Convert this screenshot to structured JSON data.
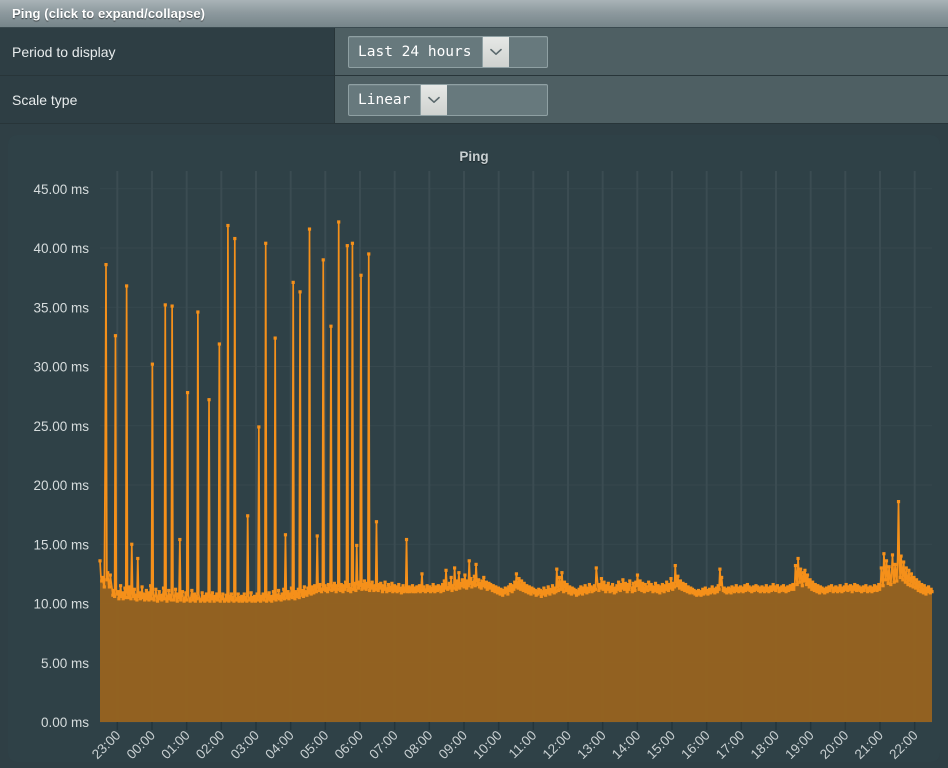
{
  "panel": {
    "header_title": "Ping (click to expand/collapse)"
  },
  "form": {
    "rows": [
      {
        "label": "Period to display",
        "control_name": "period-select",
        "value": "Last 24 hours",
        "arrow_icon": "chevron-down-icon"
      },
      {
        "label": "Scale type",
        "control_name": "scale-select",
        "value": "Linear",
        "arrow_icon": "chevron-down-icon"
      }
    ]
  },
  "colors": {
    "header_light": "#a9b3b7",
    "header_dark": "#76858a",
    "label_bg": "#2e3e44",
    "control_bg": "#4e5f63",
    "chart_bg": "#2f4147",
    "grid_line": "#3b4c52",
    "series_line": "#f5901a",
    "series_fill": "#96631f",
    "tick_text": "#d6dcdd"
  },
  "chart_data": {
    "type": "area",
    "title": "Ping",
    "xlabel": "",
    "ylabel": "",
    "unit": "ms",
    "grid": true,
    "legend": "none",
    "ylim": [
      0,
      46.5
    ],
    "ytick_values": [
      0,
      5,
      10,
      15,
      20,
      25,
      30,
      35,
      40,
      45
    ],
    "ytick_labels": [
      "0.00 ms",
      "5.00 ms",
      "10.00 ms",
      "15.00 ms",
      "20.00 ms",
      "25.00 ms",
      "30.00 ms",
      "35.00 ms",
      "40.00 ms",
      "45.00 ms"
    ],
    "xtick_labels": [
      "23:00",
      "00:00",
      "01:00",
      "02:00",
      "03:00",
      "04:00",
      "05:00",
      "06:00",
      "07:00",
      "08:00",
      "09:00",
      "10:00",
      "11:00",
      "12:00",
      "13:00",
      "14:00",
      "15:00",
      "16:00",
      "17:00",
      "18:00",
      "19:00",
      "20:00",
      "21:00",
      "22:00"
    ],
    "series": [
      {
        "name": "Ping",
        "line_color": "#f5901a",
        "fill_color": "#96631f",
        "values": [
          13.6,
          12.3,
          11.9,
          12.2,
          11.7,
          11.4,
          22.0,
          38.6,
          12.0,
          12.6,
          11.6,
          11.4,
          12.4,
          11.8,
          11.3,
          10.7,
          11.1,
          10.6,
          32.6,
          11.2,
          10.8,
          11.0,
          10.4,
          10.7,
          11.5,
          10.6,
          10.9,
          10.4,
          10.7,
          11.3,
          10.5,
          36.8,
          10.9,
          10.5,
          11.4,
          10.7,
          10.4,
          15.0,
          10.8,
          10.6,
          11.2,
          10.4,
          10.7,
          10.3,
          13.8,
          10.6,
          10.9,
          10.4,
          10.7,
          11.4,
          10.5,
          10.8,
          10.3,
          10.6,
          11.1,
          10.4,
          10.9,
          10.3,
          10.6,
          11.5,
          10.4,
          30.2,
          10.8,
          10.3,
          10.6,
          11.2,
          10.5,
          10.2,
          10.8,
          11.0,
          10.4,
          10.7,
          10.3,
          10.6,
          11.3,
          10.4,
          35.2,
          10.8,
          10.2,
          10.6,
          11.1,
          10.4,
          10.7,
          10.3,
          35.1,
          10.8,
          10.3,
          10.6,
          11.2,
          10.4,
          10.2,
          10.8,
          10.5,
          15.4,
          10.3,
          10.7,
          11.0,
          10.4,
          10.2,
          10.6,
          10.9,
          10.3,
          27.8,
          10.7,
          10.4,
          10.2,
          10.6,
          11.1,
          10.3,
          10.5,
          10.8,
          10.2,
          10.6,
          10.4,
          34.6,
          10.8,
          10.3,
          10.2,
          10.5,
          10.9,
          10.3,
          10.6,
          10.2,
          10.4,
          10.8,
          10.3,
          10.5,
          27.2,
          10.2,
          10.7,
          10.4,
          10.9,
          10.3,
          10.2,
          10.6,
          10.4,
          10.8,
          10.3,
          10.5,
          31.9,
          10.2,
          10.6,
          10.4,
          10.8,
          10.3,
          10.2,
          10.5,
          10.7,
          10.3,
          41.9,
          10.2,
          10.6,
          10.4,
          10.8,
          10.3,
          10.5,
          10.2,
          40.8,
          10.6,
          10.3,
          10.4,
          10.8,
          10.2,
          10.5,
          10.3,
          10.6,
          10.2,
          10.4,
          10.8,
          10.3,
          10.5,
          10.2,
          17.4,
          10.6,
          10.3,
          10.4,
          10.9,
          10.2,
          10.5,
          10.3,
          10.6,
          10.2,
          10.4,
          10.8,
          10.3,
          24.9,
          10.5,
          10.2,
          10.6,
          10.4,
          10.8,
          10.3,
          10.5,
          40.4,
          10.2,
          10.7,
          10.4,
          10.9,
          10.3,
          10.6,
          10.2,
          10.5,
          11.0,
          10.4,
          32.4,
          10.3,
          10.7,
          10.5,
          11.1,
          10.4,
          10.6,
          10.3,
          10.8,
          10.5,
          11.2,
          10.4,
          15.8,
          10.7,
          10.5,
          11.0,
          10.4,
          10.8,
          10.6,
          11.3,
          10.5,
          37.1,
          10.7,
          10.4,
          11.0,
          10.8,
          10.6,
          11.2,
          10.5,
          36.3,
          10.9,
          10.7,
          11.1,
          10.6,
          11.4,
          10.8,
          11.0,
          10.7,
          11.3,
          10.9,
          41.6,
          11.0,
          10.8,
          11.4,
          11.1,
          10.9,
          11.5,
          11.2,
          11.0,
          15.7,
          11.3,
          11.1,
          11.6,
          11.2,
          11.0,
          11.4,
          39.0,
          11.2,
          11.5,
          11.1,
          11.3,
          11.0,
          11.6,
          11.2,
          11.4,
          33.4,
          11.1,
          11.5,
          11.2,
          11.7,
          11.3,
          11.0,
          11.5,
          11.2,
          42.2,
          11.4,
          11.1,
          11.6,
          11.3,
          11.0,
          11.5,
          11.2,
          11.8,
          11.4,
          40.2,
          11.1,
          11.6,
          11.3,
          11.0,
          11.5,
          40.4,
          11.2,
          11.7,
          11.4,
          11.1,
          14.9,
          11.6,
          11.3,
          11.8,
          11.5,
          37.7,
          11.2,
          11.6,
          11.3,
          11.9,
          11.5,
          11.2,
          11.7,
          11.4,
          39.5,
          11.1,
          11.6,
          11.3,
          11.8,
          11.4,
          11.1,
          11.5,
          11.2,
          16.9,
          11.4,
          11.1,
          11.6,
          11.3,
          11.7,
          11.2,
          11.0,
          11.5,
          11.2,
          11.8,
          11.4,
          11.0,
          11.3,
          11.6,
          11.1,
          11.4,
          11.2,
          11.7,
          11.0,
          11.3,
          11.5,
          11.1,
          11.4,
          11.0,
          11.2,
          11.6,
          11.1,
          11.3,
          10.9,
          11.2,
          11.5,
          11.0,
          11.3,
          11.1,
          15.4,
          11.0,
          11.2,
          11.4,
          11.0,
          11.3,
          11.1,
          11.5,
          11.0,
          11.2,
          11.3,
          11.0,
          11.4,
          11.1,
          11.2,
          11.5,
          11.0,
          11.3,
          12.5,
          11.1,
          11.4,
          11.2,
          11.0,
          11.3,
          11.5,
          11.1,
          11.2,
          11.4,
          11.0,
          11.3,
          11.1,
          11.6,
          11.2,
          11.0,
          11.4,
          11.3,
          11.1,
          11.5,
          11.2,
          11.4,
          11.0,
          11.3,
          11.6,
          11.1,
          11.9,
          11.3,
          12.8,
          11.5,
          11.2,
          11.4,
          11.7,
          11.3,
          12.2,
          11.1,
          11.5,
          11.3,
          13.0,
          11.6,
          11.2,
          11.9,
          11.4,
          12.6,
          11.3,
          11.7,
          11.5,
          12.0,
          11.8,
          11.4,
          12.4,
          11.6,
          11.3,
          11.9,
          11.5,
          13.6,
          11.7,
          12.1,
          11.4,
          11.8,
          11.6,
          12.3,
          11.5,
          13.3,
          11.9,
          11.6,
          12.0,
          11.4,
          11.7,
          11.3,
          11.9,
          11.5,
          12.2,
          11.6,
          11.4,
          11.8,
          11.2,
          11.5,
          11.7,
          11.3,
          11.6,
          11.4,
          11.1,
          11.5,
          11.3,
          11.0,
          11.4,
          11.2,
          10.9,
          11.3,
          11.1,
          10.8,
          11.2,
          11.0,
          10.7,
          11.1,
          10.9,
          11.3,
          11.0,
          11.2,
          10.8,
          11.4,
          11.1,
          11.6,
          11.3,
          11.0,
          11.5,
          11.2,
          11.8,
          11.4,
          12.5,
          11.6,
          11.3,
          12.1,
          11.5,
          11.2,
          11.9,
          11.4,
          11.1,
          11.7,
          11.3,
          11.0,
          11.5,
          11.2,
          10.9,
          11.4,
          11.1,
          10.8,
          11.3,
          11.0,
          11.2,
          10.9,
          11.1,
          10.7,
          11.0,
          10.8,
          11.2,
          10.9,
          11.1,
          10.6,
          11.0,
          10.8,
          11.3,
          11.0,
          10.7,
          11.1,
          10.9,
          11.4,
          11.1,
          10.8,
          11.2,
          11.0,
          11.5,
          11.2,
          10.9,
          11.3,
          11.0,
          12.9,
          11.4,
          11.1,
          12.2,
          11.5,
          11.2,
          12.6,
          11.3,
          11.0,
          11.8,
          11.4,
          11.1,
          11.6,
          11.2,
          10.9,
          11.4,
          11.1,
          10.8,
          11.3,
          11.0,
          11.2,
          10.9,
          11.1,
          10.7,
          11.0,
          10.8,
          11.2,
          10.9,
          11.4,
          11.1,
          10.8,
          11.3,
          11.0,
          11.5,
          11.2,
          10.9,
          11.3,
          11.0,
          11.6,
          11.2,
          11.4,
          11.0,
          11.3,
          11.1,
          11.5,
          11.2,
          13.0,
          12.2,
          11.4,
          11.1,
          11.6,
          11.3,
          12.1,
          11.5,
          11.2,
          11.8,
          11.4,
          11.0,
          11.5,
          11.2,
          11.7,
          11.3,
          11.0,
          11.4,
          11.1,
          11.6,
          11.2,
          10.9,
          11.3,
          11.0,
          11.5,
          11.2,
          11.8,
          11.4,
          11.1,
          11.6,
          11.3,
          12.0,
          11.5,
          11.2,
          11.7,
          11.4,
          11.0,
          11.6,
          11.2,
          11.9,
          11.5,
          11.3,
          11.0,
          11.7,
          11.4,
          11.1,
          11.8,
          11.5,
          12.4,
          11.6,
          11.2,
          11.9,
          11.4,
          11.1,
          11.7,
          11.3,
          11.0,
          11.6,
          11.2,
          11.4,
          11.1,
          11.8,
          11.5,
          11.2,
          11.6,
          11.3,
          11.0,
          11.4,
          11.1,
          11.7,
          11.3,
          11.0,
          11.5,
          11.2,
          10.9,
          11.4,
          11.1,
          11.6,
          11.3,
          11.0,
          11.5,
          11.2,
          11.8,
          11.4,
          11.1,
          11.6,
          11.3,
          12.1,
          11.5,
          11.2,
          11.7,
          11.4,
          13.2,
          11.8,
          11.5,
          12.3,
          11.6,
          11.3,
          11.9,
          11.5,
          11.2,
          11.7,
          11.4,
          11.1,
          11.6,
          11.2,
          11.0,
          11.4,
          11.1,
          10.9,
          11.3,
          11.0,
          11.2,
          10.9,
          11.1,
          10.8,
          11.0,
          10.7,
          10.9,
          11.1,
          10.8,
          11.0,
          10.7,
          10.9,
          11.2,
          10.8,
          11.0,
          11.3,
          10.9,
          11.1,
          10.8,
          11.0,
          11.2,
          10.9,
          11.1,
          11.4,
          11.0,
          11.2,
          10.9,
          11.1,
          11.3,
          11.0,
          11.5,
          11.2,
          12.9,
          11.6,
          12.2,
          11.4,
          11.1,
          11.3,
          11.0,
          11.2,
          10.9,
          11.1,
          11.3,
          11.0,
          11.2,
          10.9,
          11.4,
          11.1,
          11.3,
          11.0,
          11.2,
          11.5,
          11.1,
          11.3,
          11.0,
          11.2,
          11.4,
          11.1,
          11.3,
          11.0,
          11.2,
          11.5,
          11.1,
          11.3,
          11.6,
          11.2,
          11.4,
          11.1,
          11.3,
          11.0,
          11.2,
          11.4,
          11.1,
          11.3,
          11.5,
          11.2,
          11.4,
          11.1,
          11.3,
          11.0,
          11.2,
          11.4,
          11.1,
          11.3,
          11.0,
          11.2,
          11.5,
          11.1,
          11.3,
          11.0,
          11.2,
          11.4,
          11.1,
          11.3,
          11.6,
          11.2,
          11.4,
          11.1,
          11.3,
          11.5,
          11.2,
          11.0,
          11.3,
          11.1,
          11.4,
          11.2,
          11.5,
          11.1,
          11.3,
          11.0,
          11.2,
          11.4,
          11.1,
          11.3,
          11.5,
          11.2,
          11.4,
          11.6,
          11.2,
          11.4,
          13.2,
          12.3,
          11.6,
          13.8,
          12.5,
          11.8,
          12.9,
          12.2,
          11.5,
          12.6,
          11.9,
          12.8,
          12.1,
          11.6,
          12.4,
          11.8,
          11.4,
          12.0,
          11.6,
          11.2,
          11.8,
          11.4,
          11.1,
          11.6,
          11.3,
          11.0,
          11.5,
          11.2,
          10.9,
          11.4,
          11.1,
          11.3,
          11.0,
          11.2,
          10.9,
          11.1,
          11.3,
          11.0,
          11.2,
          11.4,
          11.1,
          11.3,
          11.5,
          11.2,
          11.0,
          11.3,
          11.1,
          11.4,
          11.2,
          11.0,
          11.3,
          11.1,
          11.5,
          11.2,
          11.0,
          11.3,
          11.1,
          11.4,
          11.2,
          11.6,
          11.3,
          11.1,
          11.4,
          11.2,
          11.5,
          11.3,
          11.0,
          11.4,
          11.2,
          11.6,
          11.3,
          11.1,
          11.5,
          11.2,
          11.4,
          11.1,
          11.3,
          11.0,
          11.2,
          11.4,
          11.1,
          11.3,
          11.5,
          11.2,
          11.0,
          11.3,
          11.1,
          11.4,
          11.2,
          11.0,
          11.3,
          11.1,
          11.5,
          11.2,
          11.4,
          11.1,
          11.3,
          11.6,
          11.2,
          11.4,
          13.0,
          12.1,
          11.5,
          14.2,
          12.8,
          12.0,
          13.6,
          12.4,
          11.7,
          13.1,
          12.2,
          11.6,
          12.7,
          14.1,
          12.3,
          11.8,
          13.3,
          12.5,
          11.9,
          13.8,
          18.6,
          13.4,
          12.2,
          14.0,
          12.7,
          12.0,
          13.5,
          12.4,
          11.8,
          13.0,
          12.1,
          11.6,
          12.8,
          12.0,
          11.5,
          12.5,
          11.9,
          11.4,
          12.2,
          11.7,
          11.3,
          12.0,
          11.5,
          11.1,
          11.8,
          11.4,
          11.0,
          11.6,
          11.2,
          10.9,
          11.5,
          11.1,
          10.8,
          11.3,
          11.0,
          11.4,
          11.1,
          10.9,
          11.2,
          11.0
        ]
      }
    ]
  }
}
